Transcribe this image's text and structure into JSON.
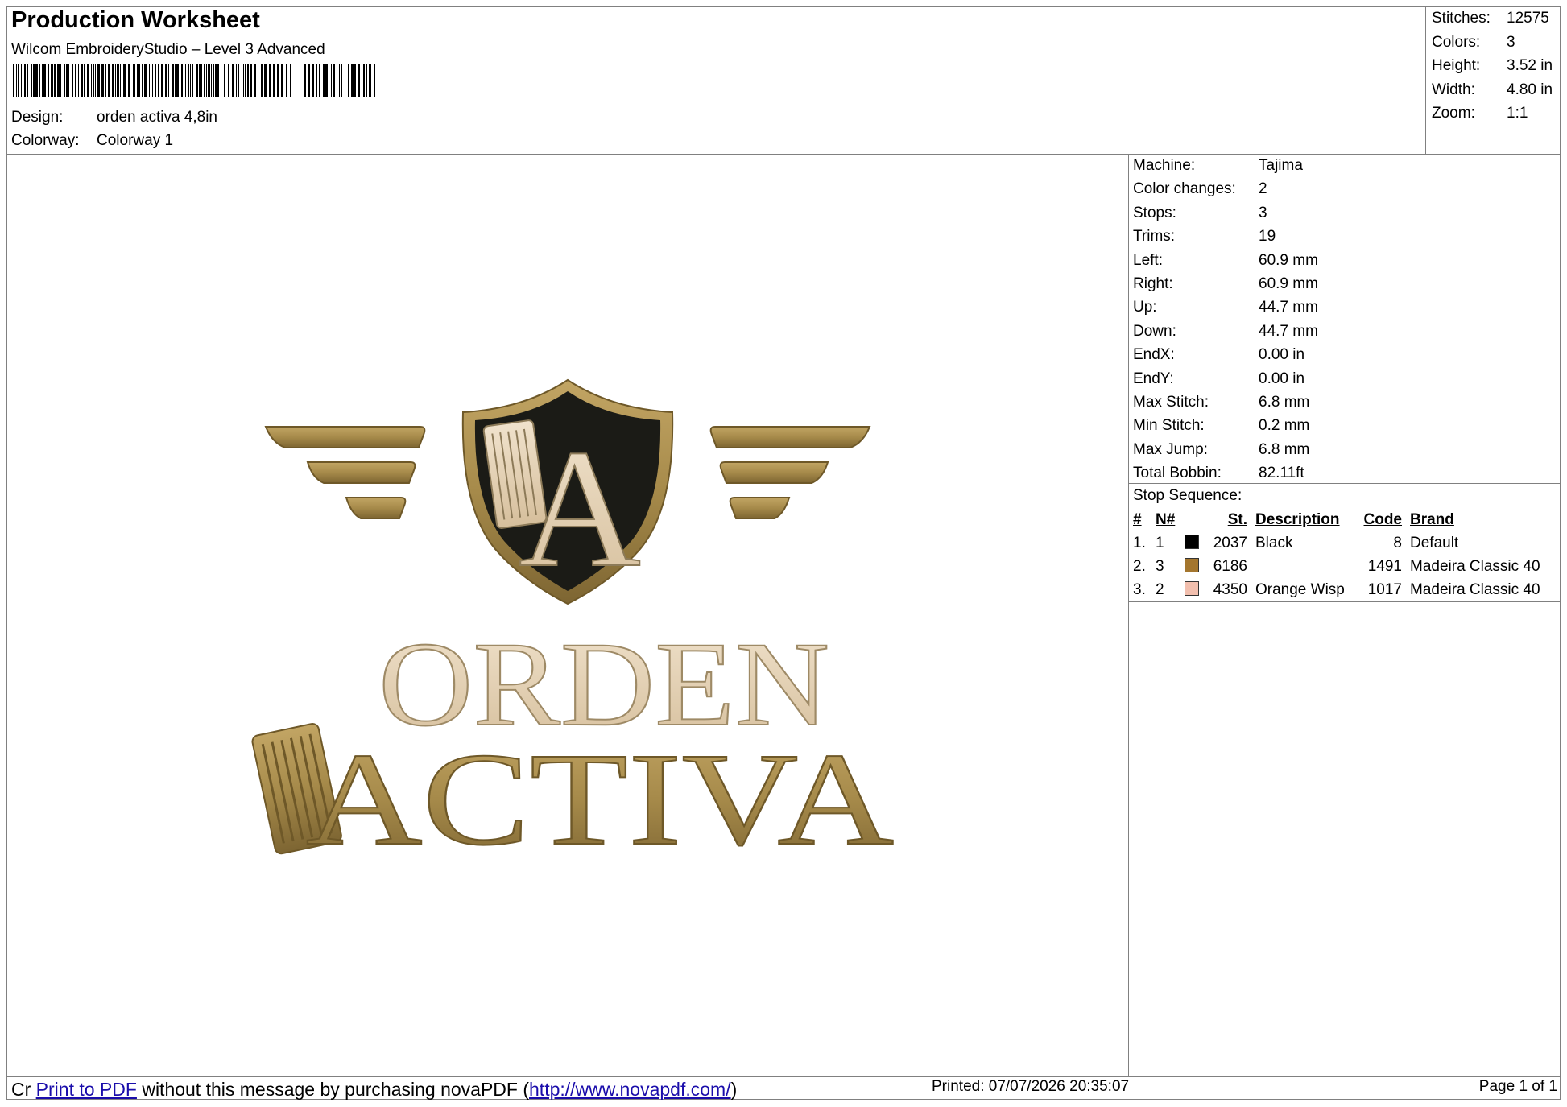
{
  "header": {
    "title": "Production Worksheet",
    "software": "Wilcom EmbroideryStudio – Level 3 Advanced",
    "design_label": "Design:",
    "design_value": "orden activa 4,8in",
    "colorway_label": "Colorway:",
    "colorway_value": "Colorway 1"
  },
  "stats": [
    {
      "label": "Stitches:",
      "value": "12575"
    },
    {
      "label": "Colors:",
      "value": "3"
    },
    {
      "label": "Height:",
      "value": "3.52 in"
    },
    {
      "label": "Width:",
      "value": "4.80 in"
    },
    {
      "label": "Zoom:",
      "value": "1:1"
    }
  ],
  "info": [
    {
      "label": "Machine:",
      "value": "Tajima"
    },
    {
      "label": "Color changes:",
      "value": "2"
    },
    {
      "label": "Stops:",
      "value": "3"
    },
    {
      "label": "Trims:",
      "value": "19"
    },
    {
      "label": "Left:",
      "value": "60.9 mm"
    },
    {
      "label": "Right:",
      "value": "60.9 mm"
    },
    {
      "label": "Up:",
      "value": "44.7 mm"
    },
    {
      "label": "Down:",
      "value": "44.7 mm"
    },
    {
      "label": "EndX:",
      "value": "0.00 in"
    },
    {
      "label": "EndY:",
      "value": "0.00 in"
    },
    {
      "label": "Max Stitch:",
      "value": "6.8 mm"
    },
    {
      "label": "Min Stitch:",
      "value": "0.2 mm"
    },
    {
      "label": "Max Jump:",
      "value": "6.8 mm"
    },
    {
      "label": "Total Bobbin:",
      "value": "82.11ft"
    }
  ],
  "stop_sequence": {
    "title": "Stop Sequence:",
    "headers": {
      "num": "#",
      "n": "N#",
      "st": "St.",
      "description": "Description",
      "code": "Code",
      "brand": "Brand"
    },
    "rows": [
      {
        "num": "1.",
        "n": "1",
        "color": "#000000",
        "st": "2037",
        "description": "Black",
        "code": "8",
        "brand": "Default"
      },
      {
        "num": "2.",
        "n": "3",
        "color": "#A4762E",
        "st": "6186",
        "description": "",
        "code": "1491",
        "brand": "Madeira Classic 40"
      },
      {
        "num": "3.",
        "n": "2",
        "color": "#F2BFAE",
        "st": "4350",
        "description": "Orange Wisp",
        "code": "1017",
        "brand": "Madeira Classic 40"
      }
    ]
  },
  "design_text": {
    "shield_letter": "A",
    "line1": "ORDEN",
    "line2": "ACTIVA",
    "gold": "#A68A4A",
    "cream": "#E4D2B6",
    "black": "#1B1B16"
  },
  "footer": {
    "prefix": "Cr",
    "link1": "Print to PDF",
    "middle": " without this message by purchasing novaPDF (",
    "link2": "http://www.novapdf.com/",
    "suffix": ")",
    "printed": "Printed: 07/07/2026 20:35:07",
    "page": "Page 1 of 1"
  }
}
